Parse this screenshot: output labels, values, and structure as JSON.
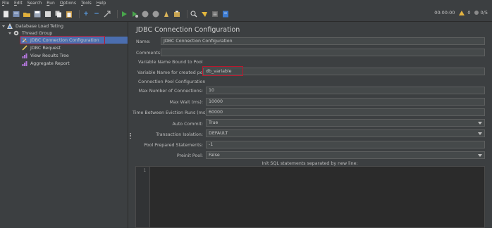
{
  "menu": [
    {
      "label": "File",
      "u": "F"
    },
    {
      "label": "Edit",
      "u": "E"
    },
    {
      "label": "Search",
      "u": "S"
    },
    {
      "label": "Run",
      "u": "R"
    },
    {
      "label": "Options",
      "u": "O"
    },
    {
      "label": "Tools",
      "u": "T"
    },
    {
      "label": "Help",
      "u": "H"
    }
  ],
  "toolbar": {
    "timer": "00:00:00",
    "warnings": "0",
    "threads": "0/5",
    "icons": [
      "new-icon",
      "templates-icon",
      "open-icon",
      "save-icon",
      "cut-icon",
      "copy-icon",
      "paste-icon",
      "expand-icon",
      "collapse-icon",
      "toggle-icon",
      "start-icon",
      "start-no-pause-icon",
      "stop-icon",
      "shutdown-icon",
      "clear-icon",
      "clear-all-icon",
      "search-icon",
      "reset-search-icon",
      "function-helper-icon",
      "help-icon"
    ]
  },
  "tree": {
    "root": "Database Load Teting",
    "thread_group": "Thread Group",
    "items": [
      "JDBC Connection Configuration",
      "JDBC Request",
      "View Results Tree",
      "Aggregate Report"
    ]
  },
  "panel": {
    "title": "JDBC Connection Configuration",
    "name_label": "Name:",
    "name_value": "JDBC Connection Configuration",
    "comments_label": "Comments:",
    "comments_value": "",
    "bound_section": "Variable Name Bound to Pool",
    "var_label": "Variable Name for created pool:",
    "var_value": "db_variable",
    "pool_section": "Connection Pool Configuration",
    "max_conn_label": "Max Number of Connections:",
    "max_conn_value": "10",
    "max_wait_label": "Max Wait (ms):",
    "max_wait_value": "10000",
    "eviction_label": "Time Between Eviction Runs (ms):",
    "eviction_value": "60000",
    "auto_commit_label": "Auto Commit:",
    "auto_commit_value": "True",
    "isolation_label": "Transaction Isolation:",
    "isolation_value": "DEFAULT",
    "prepared_label": "Pool Prepared Statements:",
    "prepared_value": "-1",
    "preinit_label": "Preinit Pool:",
    "preinit_value": "False",
    "sql_header": "Init SQL statements separated by new line:",
    "line_number": "1"
  },
  "colors": {
    "highlight_box": "#b8182e",
    "selection": "#4b6eaf",
    "background": "#3c3f41"
  }
}
